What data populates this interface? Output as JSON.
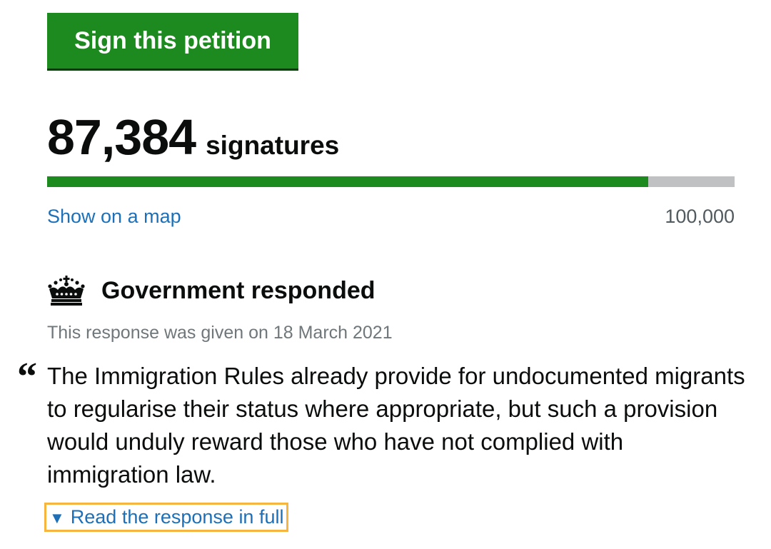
{
  "sign_button": {
    "label": "Sign this petition"
  },
  "signatures": {
    "count": "87,384",
    "label": "signatures",
    "target": "100,000",
    "progress_fraction": 0.87384,
    "map_link": "Show on a map"
  },
  "response": {
    "heading": "Government responded",
    "date_text": "This response was given on 18 March 2021",
    "quote_mark": "“",
    "summary": "The Immigration Rules already provide for undocumented migrants to regularise their status where appropriate, but such a provision would unduly reward those who have not complied with immigration law.",
    "read_full_label": "Read the response in full",
    "read_full_icon": "triangle-down-icon"
  },
  "colors": {
    "accent_green": "#1d8a1f",
    "link_blue": "#1d70b8",
    "focus_outline": "#f5b53f",
    "progress_track": "#bfc1c3"
  }
}
